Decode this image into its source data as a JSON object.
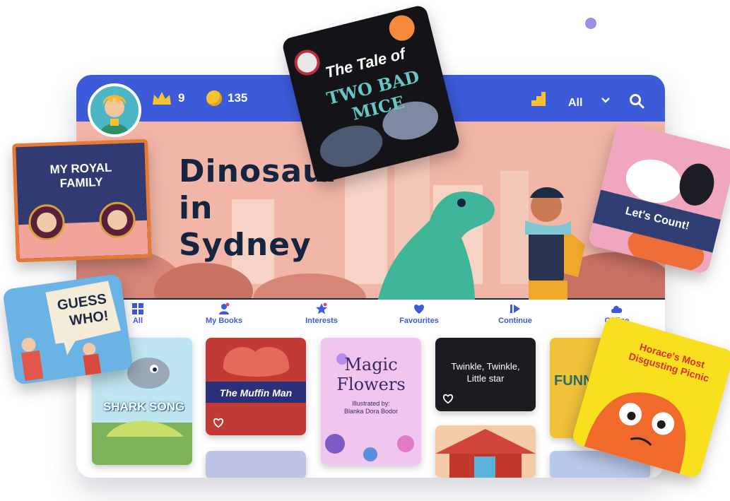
{
  "stats": {
    "crowns": "9",
    "coins": "135"
  },
  "filter": {
    "selected": "All"
  },
  "hero": {
    "title_line1": "Dinosaur",
    "title_line2": "in Sydney"
  },
  "nav": {
    "items": [
      {
        "label": "All"
      },
      {
        "label": "My Books"
      },
      {
        "label": "Interests"
      },
      {
        "label": "Favourites"
      },
      {
        "label": "Continue"
      },
      {
        "label": "Offline"
      }
    ]
  },
  "books": [
    {
      "title": "SHARK SONG"
    },
    {
      "title": "The Muffin Man"
    },
    {
      "title": "Magic Flowers",
      "credit": "Illustrated by:",
      "illustrator": "Blanka Dora Bodor"
    },
    {
      "title": "Twinkle, Twinkle, Little star"
    },
    {
      "title": "FUNNY"
    }
  ],
  "cards": {
    "mice": "The Tale of",
    "mice2": "TWO BAD",
    "mice3": "MICE",
    "royal": "MY ROYAL",
    "royal2": "FAMILY",
    "count": "Let's Count!",
    "guess": "GUESS",
    "guess2": "WHO!",
    "horace": "Horace's Most Disgusting Picnic"
  },
  "colors": {
    "brand": "#3d5bd9",
    "crown": "#f7c12f"
  }
}
